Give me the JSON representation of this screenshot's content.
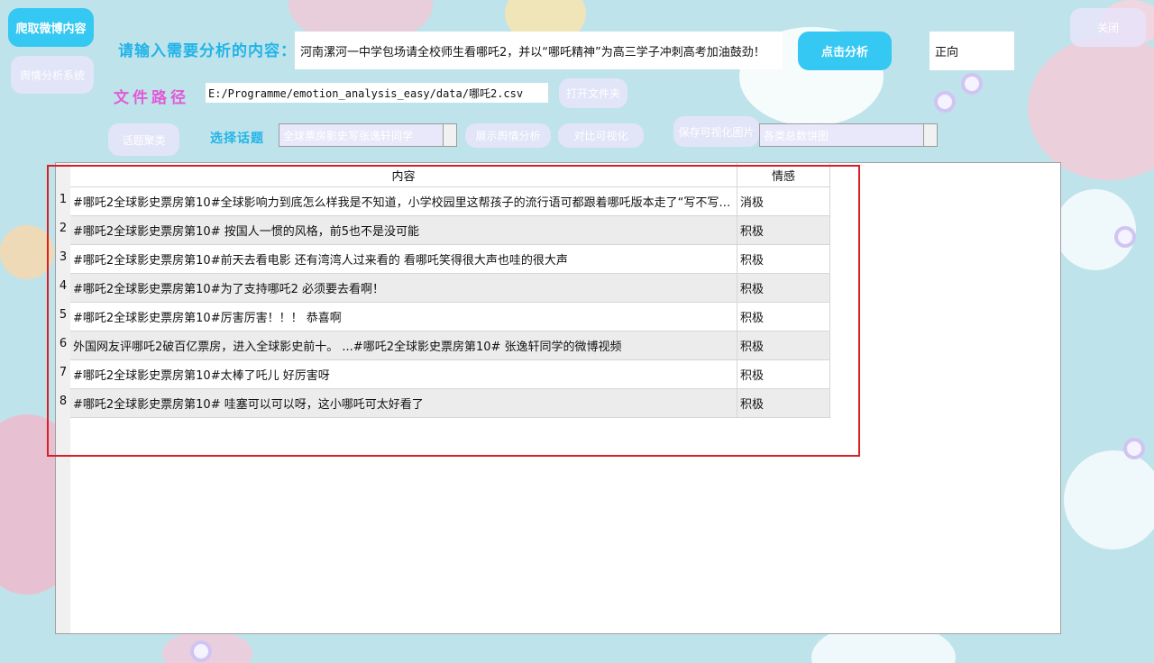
{
  "buttons": {
    "crawl": "爬取微博内容",
    "system": "舆情分析系统",
    "analyze": "点击分析",
    "close": "关闭",
    "open_folder": "打开文件夹",
    "topic_cluster": "话题聚类",
    "show_analysis": "展示舆情分析",
    "compare_viz": "对比可视化",
    "save_viz": "保存可视化图片"
  },
  "labels": {
    "input_prompt": "请输入需要分析的内容：",
    "file_path": "文件路径",
    "select_topic": "选择话题"
  },
  "inputs": {
    "content_value": "河南漯河一中学包场请全校师生看哪吒2，并以“哪吒精神”为高三学子冲刺高考加油鼓劲！",
    "result_value": "正向",
    "file_path_value": "E:/Programme/emotion_analysis_easy/data/哪吒2.csv"
  },
  "selects": {
    "topic": "全球票房影史写张逸轩同学",
    "chart_type": "各类总数饼图"
  },
  "table": {
    "columns": [
      "内容",
      "情感"
    ],
    "rows": [
      {
        "index": "1",
        "content": "#哪吒2全球影史票房第10#全球影响力到底怎么样我是不知道，小学校园里这帮孩子的流行语可都跟着哪吒版本走了“写不写作...",
        "sentiment": "消极"
      },
      {
        "index": "2",
        "content": "#哪吒2全球影史票房第10# 按国人一惯的风格，前5也不是没可能",
        "sentiment": "积极"
      },
      {
        "index": "3",
        "content": "#哪吒2全球影史票房第10#前天去看电影 还有湾湾人过来看的 看哪吒笑得很大声也哇的很大声",
        "sentiment": "积极"
      },
      {
        "index": "4",
        "content": "#哪吒2全球影史票房第10#为了支持哪吒2 必须要去看啊！",
        "sentiment": "积极"
      },
      {
        "index": "5",
        "content": "#哪吒2全球影史票房第10#厉害厉害！！！ 恭喜啊",
        "sentiment": "积极"
      },
      {
        "index": "6",
        "content": "外国网友评哪吒2破百亿票房，进入全球影史前十。 ...#哪吒2全球影史票房第10# 张逸轩同学的微博视频",
        "sentiment": "积极"
      },
      {
        "index": "7",
        "content": "#哪吒2全球影史票房第10#太棒了吒儿 好厉害呀",
        "sentiment": "积极"
      },
      {
        "index": "8",
        "content": "#哪吒2全球影史票房第10# 哇塞可以可以呀，这小哪吒可太好看了",
        "sentiment": "积极"
      }
    ]
  },
  "colors": {
    "accent_blue": "#35c8f2",
    "highlight_red": "#d81f26"
  }
}
